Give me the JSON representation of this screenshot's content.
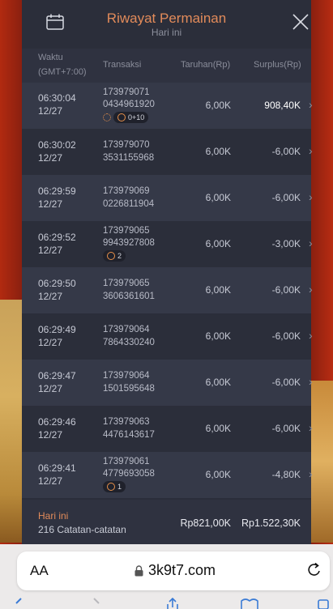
{
  "header": {
    "title": "Riwayat Permainan",
    "subtitle": "Hari ini",
    "calendar_icon": "calendar-icon",
    "close_icon": "close-icon"
  },
  "columns": {
    "time_line1": "Waktu",
    "time_line2": "(GMT+7:00)",
    "transaction": "Transaksi",
    "bet": "Taruhan(Rp)",
    "surplus": "Surplus(Rp)"
  },
  "rows": [
    {
      "time": "06:30:04",
      "date": "12/27",
      "tx1": "173979071",
      "tx2": "0434961920",
      "bet": "6,00K",
      "surplus": "908,40K",
      "badge": "0+10",
      "win": true
    },
    {
      "time": "06:30:02",
      "date": "12/27",
      "tx1": "173979070",
      "tx2": "3531155968",
      "bet": "6,00K",
      "surplus": "-6,00K"
    },
    {
      "time": "06:29:59",
      "date": "12/27",
      "tx1": "173979069",
      "tx2": "0226811904",
      "bet": "6,00K",
      "surplus": "-6,00K"
    },
    {
      "time": "06:29:52",
      "date": "12/27",
      "tx1": "173979065",
      "tx2": "9943927808",
      "bet": "6,00K",
      "surplus": "-3,00K",
      "badge": "2"
    },
    {
      "time": "06:29:50",
      "date": "12/27",
      "tx1": "173979065",
      "tx2": "3606361601",
      "bet": "6,00K",
      "surplus": "-6,00K"
    },
    {
      "time": "06:29:49",
      "date": "12/27",
      "tx1": "173979064",
      "tx2": "7864330240",
      "bet": "6,00K",
      "surplus": "-6,00K"
    },
    {
      "time": "06:29:47",
      "date": "12/27",
      "tx1": "173979064",
      "tx2": "1501595648",
      "bet": "6,00K",
      "surplus": "-6,00K"
    },
    {
      "time": "06:29:46",
      "date": "12/27",
      "tx1": "173979063",
      "tx2": "4476143617",
      "bet": "6,00K",
      "surplus": "-6,00K"
    },
    {
      "time": "06:29:41",
      "date": "12/27",
      "tx1": "173979061",
      "tx2": "4779693058",
      "bet": "6,00K",
      "surplus": "-4,80K",
      "badge": "1"
    }
  ],
  "footer": {
    "period": "Hari ini",
    "records": "216 Catatan-catatan",
    "total_bet": "Rp821,00K",
    "total_surplus": "Rp1.522,30K"
  },
  "browser": {
    "aa": "AA",
    "domain": "3k9t7.com",
    "lock_icon": "lock-icon",
    "reload_icon": "reload-icon"
  },
  "colors": {
    "accent": "#e28b5a",
    "panel": "#2b2e3a",
    "row_alt": "#353948"
  }
}
